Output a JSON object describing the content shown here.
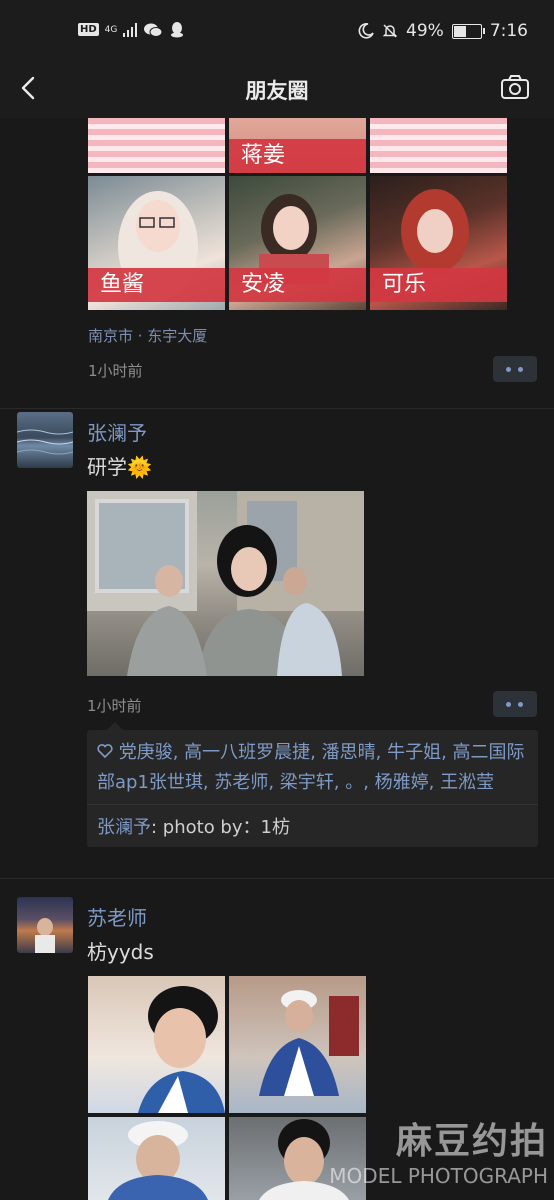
{
  "status_bar": {
    "hd": "HD",
    "network": "4G",
    "battery_text": "49%",
    "battery_level": 0.49,
    "time": "7:16"
  },
  "nav": {
    "title": "朋友圈",
    "back_icon": "chevron-left-icon",
    "camera_icon": "camera-icon"
  },
  "posts": [
    {
      "photo_labels": [
        "蒋姜",
        "鱼酱",
        "安凌",
        "可乐"
      ],
      "location": "南京市 · 东宇大厦",
      "time": "1小时前"
    },
    {
      "author": "张澜予",
      "text": "研学",
      "emoji": "🌞",
      "time": "1小时前",
      "likes": "党庚骏, 高一八班罗晨捷, 潘思晴, 牛子姐, 高二国际部ap1张世琪, 苏老师, 梁宇轩, 。, 杨雅婷, 王淞莹",
      "comments": [
        {
          "name": "张澜予",
          "text": ": photo by：1枋"
        }
      ]
    },
    {
      "author": "苏老师",
      "text": "枋yyds"
    }
  ],
  "watermark": {
    "logo": "麻豆约拍",
    "sub": "MODEL PHOTOGRAPH"
  }
}
